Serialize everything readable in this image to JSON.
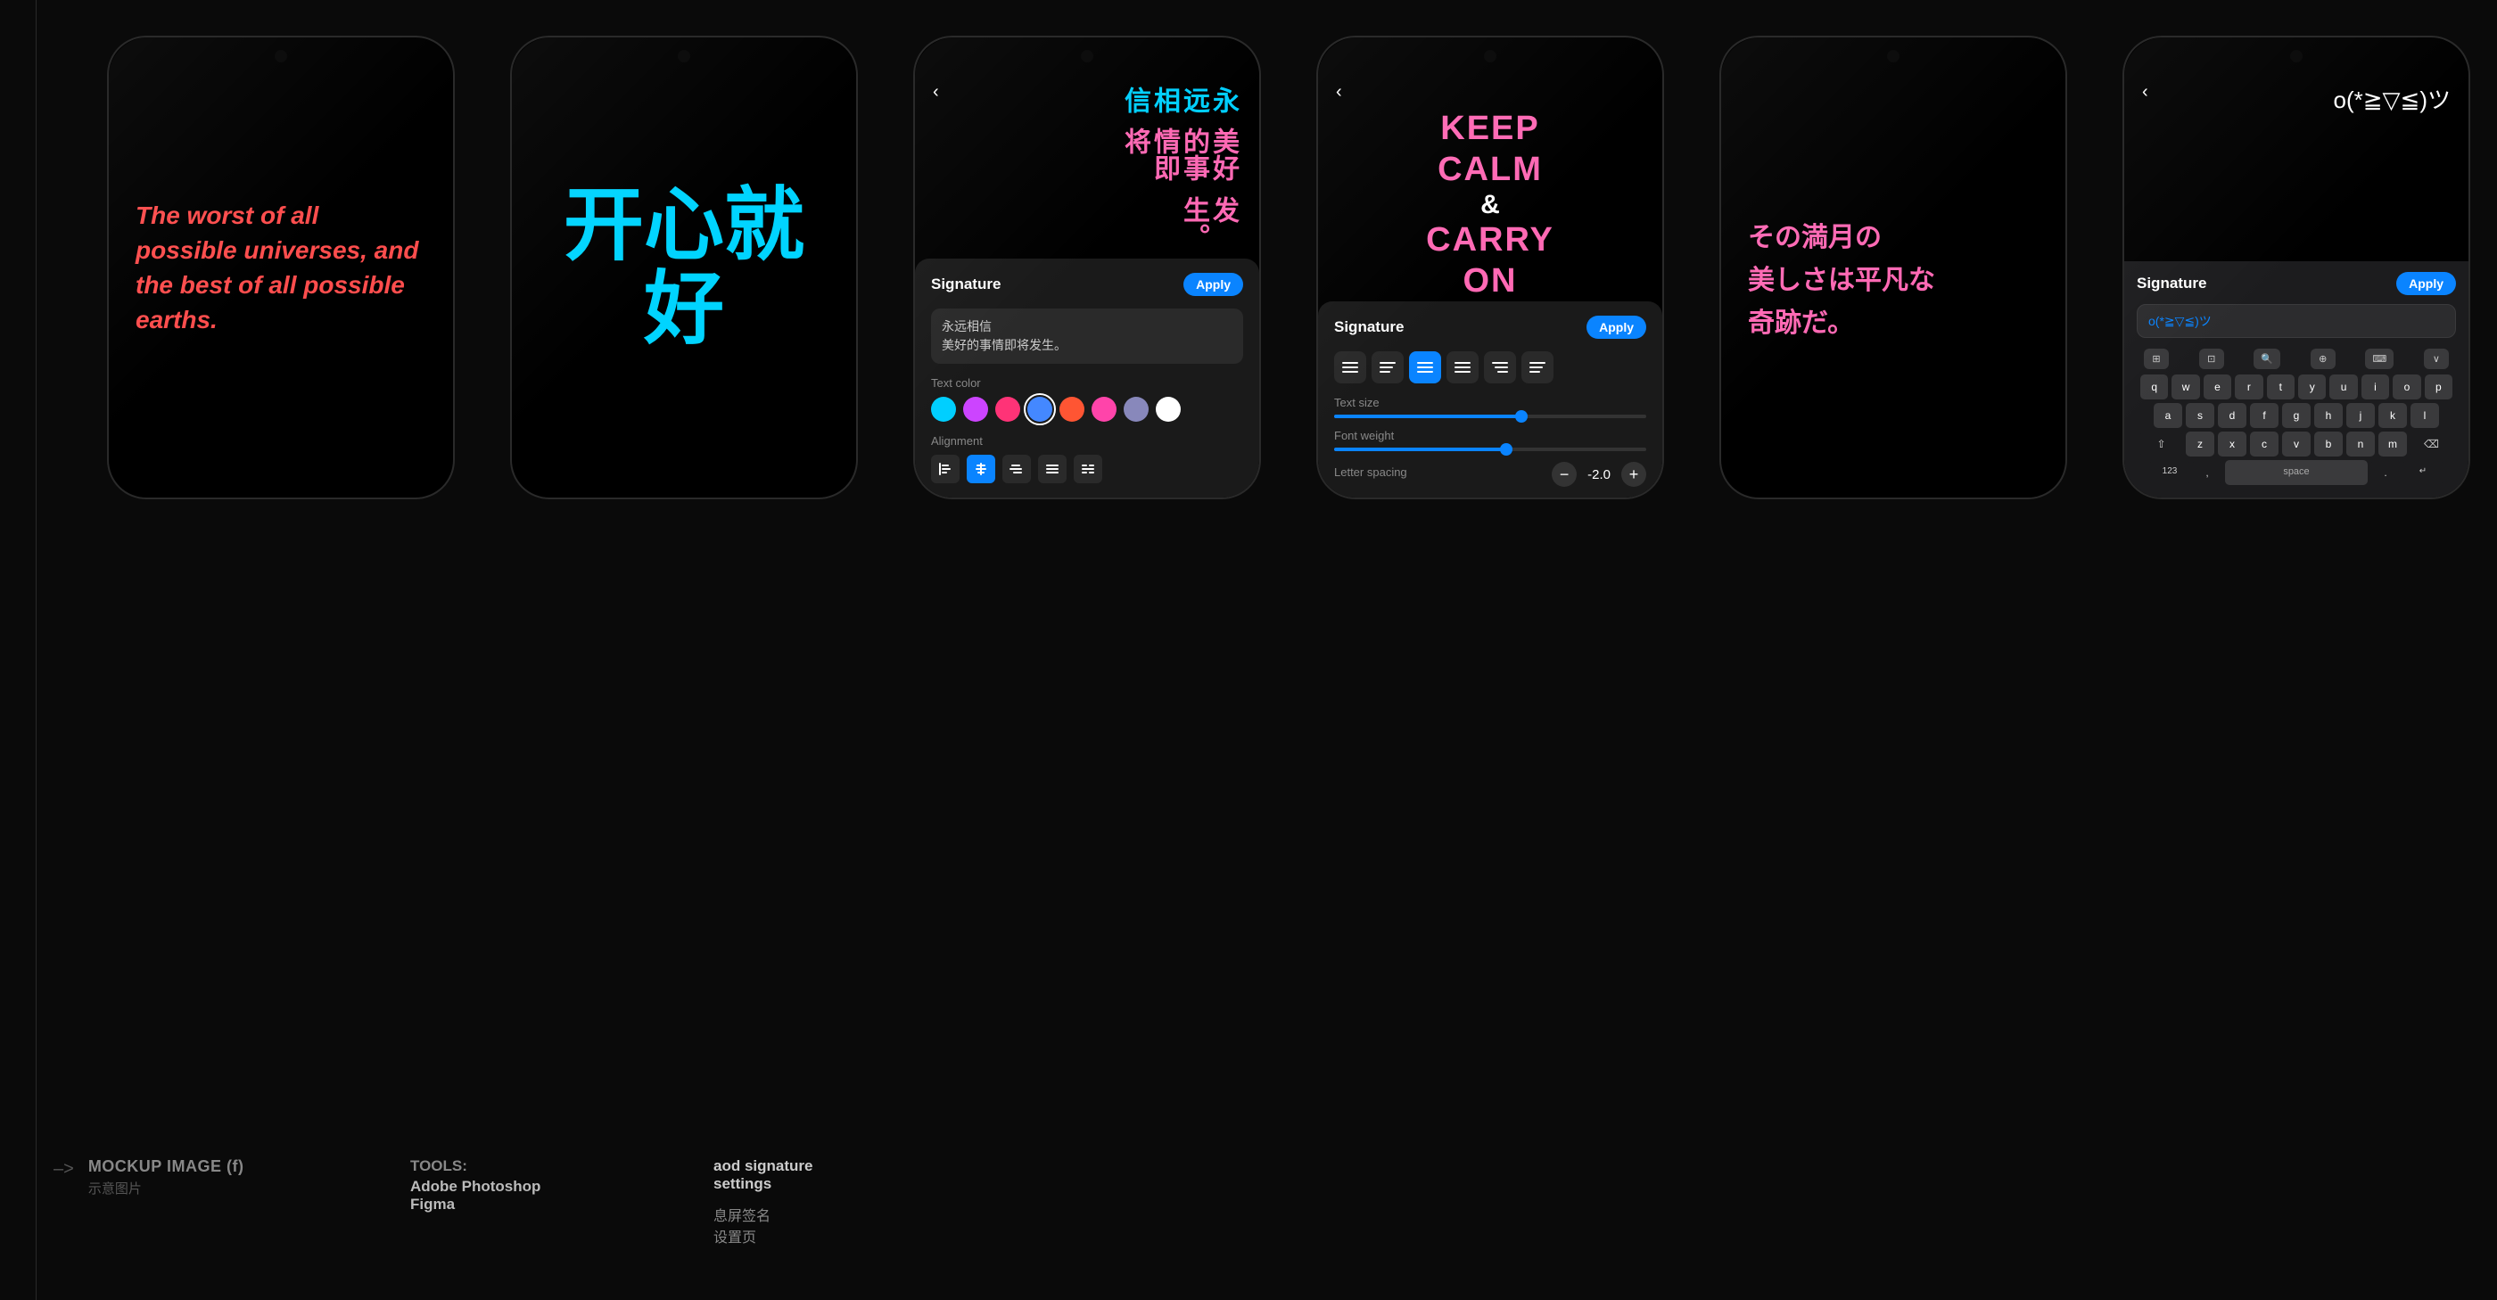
{
  "page": {
    "bg": "#0a0a0a",
    "title": "aod signature settings"
  },
  "phones": [
    {
      "id": "phone1",
      "type": "english-quote",
      "text": "The worst of all possible universes, and the best of all possible earths.",
      "textColor": "#ff4d4d"
    },
    {
      "id": "phone2",
      "type": "chinese-big",
      "text": "开心就好",
      "textColor": "#00d4ff"
    },
    {
      "id": "phone3",
      "type": "settings-chinese",
      "topText1": "永远相信",
      "topText2": "美好的事情即将",
      "topText3": "发生。",
      "textColor1": "#00cfff",
      "textColor2": "#ff69b4",
      "inputText": "永远相信\n美好的事情即将发生。",
      "signatureLabel": "Signature",
      "applyLabel": "Apply",
      "colorLabel": "Text color",
      "alignLabel": "Alignment",
      "colors": [
        "#00cfff",
        "#cc88ff",
        "#ff6699",
        "#4488ff",
        "#ff6644",
        "#ff44aa",
        "#aaaacc",
        "#ffffff"
      ],
      "selectedColor": 3
    },
    {
      "id": "phone4",
      "type": "keep-calm",
      "line1": "KEEP",
      "line2": "CALM",
      "line3": "&",
      "line4": "CARRY",
      "line5": "ON",
      "textColor": "#ff69b4",
      "signatureLabel": "Signature",
      "applyLabel": "Apply",
      "textSizeLabel": "Text size",
      "fontWeightLabel": "Font weight",
      "letterSpacingLabel": "Letter spacing",
      "letterSpacingValue": "-2.0",
      "textSizePercent": 60,
      "fontWeightPercent": 55,
      "alignOptions": [
        "left-vert",
        "center-vert",
        "right-vert",
        "left-horiz",
        "center-horiz",
        "right-horiz"
      ]
    },
    {
      "id": "phone5",
      "type": "japanese",
      "text1": "その満月の",
      "text2": "美しさは平凡な",
      "text3": "奇跡だ。",
      "textColorPink": "#ff69b4",
      "textColorCyan": "#00d4ff"
    },
    {
      "id": "phone6",
      "type": "keyboard",
      "emojiText": "o(*≧▽≦)ツ",
      "signatureLabel": "Signature",
      "applyLabel": "Apply",
      "inputValue": "o(*≧▽≦)ツ",
      "keyboardRows": [
        [
          "q",
          "w",
          "e",
          "r",
          "t",
          "y",
          "u",
          "i",
          "o",
          "p"
        ],
        [
          "a",
          "s",
          "d",
          "f",
          "g",
          "h",
          "j",
          "k",
          "l"
        ],
        [
          "z",
          "x",
          "c",
          "v",
          "b",
          "n",
          "m"
        ]
      ],
      "topKeys": [
        "⊞",
        "⊡",
        "✦",
        "⊕",
        "⌨",
        "∨"
      ],
      "spaceLabel": "space"
    }
  ],
  "footer": {
    "arrowLabel": "–>",
    "mockupLabel": "MOCKUP IMAGE (f)",
    "mockupSub": "示意图片",
    "toolsLabel": "TOOLS:",
    "tool1": "Adobe Photoshop",
    "tool2": "Figma",
    "projectLabel": "aod signature",
    "projectSub1": "settings",
    "projectSub2": "息屏签名",
    "projectSub3": "设置页"
  }
}
